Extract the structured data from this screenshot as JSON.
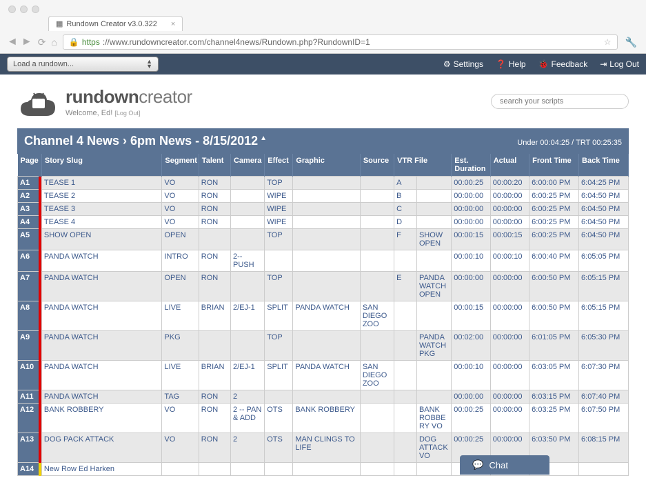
{
  "browser": {
    "tab_title": "Rundown Creator v3.0.322",
    "url_https": "https",
    "url_rest": "://www.rundowncreator.com/channel4news/Rundown.php?RundownID=1"
  },
  "header": {
    "load_label": "Load a rundown...",
    "settings": "Settings",
    "help": "Help",
    "feedback": "Feedback",
    "logout": "Log Out"
  },
  "logo": {
    "rundown": "rundown",
    "creator": "creator",
    "welcome": "Welcome, Ed!",
    "welcome_logout": "[Log Out]"
  },
  "search": {
    "placeholder": "search your scripts"
  },
  "title": {
    "channel": "Channel 4 News",
    "show": "6pm News - 8/15/2012"
  },
  "timing": {
    "under_label": "Under",
    "under_val": "00:04:25",
    "trt_label": "TRT",
    "trt_val": "00:25:35"
  },
  "columns": {
    "page": "Page",
    "slug": "Story Slug",
    "segment": "Segment",
    "talent": "Talent",
    "camera": "Camera",
    "effect": "Effect",
    "graphic": "Graphic",
    "source": "Source",
    "vtrfile": "VTR File",
    "est": "Est. Duration",
    "actual": "Actual",
    "front": "Front Time",
    "back": "Back Time"
  },
  "rows": [
    {
      "page": "A1",
      "slug": "TEASE 1",
      "segment": "VO",
      "talent": "RON",
      "camera": "",
      "effect": "TOP",
      "graphic": "",
      "source": "",
      "vtrfile": "A",
      "est": "00:00:25",
      "actual": "00:00:20",
      "front": "6:00:00 PM",
      "back": "6:04:25 PM",
      "bar": "red",
      "odd": true
    },
    {
      "page": "A2",
      "slug": "TEASE 2",
      "segment": "VO",
      "talent": "RON",
      "camera": "",
      "effect": "WIPE",
      "graphic": "",
      "source": "",
      "vtrfile": "B",
      "est": "00:00:00",
      "actual": "00:00:00",
      "front": "6:00:25 PM",
      "back": "6:04:50 PM",
      "bar": "red",
      "odd": false
    },
    {
      "page": "A3",
      "slug": "TEASE 3",
      "segment": "VO",
      "talent": "RON",
      "camera": "",
      "effect": "WIPE",
      "graphic": "",
      "source": "",
      "vtrfile": "C",
      "est": "00:00:00",
      "actual": "00:00:00",
      "front": "6:00:25 PM",
      "back": "6:04:50 PM",
      "bar": "red",
      "odd": true
    },
    {
      "page": "A4",
      "slug": "TEASE 4",
      "segment": "VO",
      "talent": "RON",
      "camera": "",
      "effect": "WIPE",
      "graphic": "",
      "source": "",
      "vtrfile": "D",
      "est": "00:00:00",
      "actual": "00:00:00",
      "front": "6:00:25 PM",
      "back": "6:04:50 PM",
      "bar": "red",
      "odd": false
    },
    {
      "page": "A5",
      "slug": "SHOW OPEN",
      "segment": "OPEN",
      "talent": "",
      "camera": "",
      "effect": "TOP",
      "graphic": "",
      "source": "",
      "vtrfile": "F",
      "vtr2": "SHOW OPEN",
      "est": "00:00:15",
      "actual": "00:00:15",
      "front": "6:00:25 PM",
      "back": "6:04:50 PM",
      "bar": "red",
      "odd": true
    },
    {
      "page": "A6",
      "slug": "PANDA WATCH",
      "segment": "INTRO",
      "talent": "RON",
      "camera": "2--PUSH",
      "effect": "",
      "graphic": "",
      "source": "",
      "vtrfile": "",
      "est": "00:00:10",
      "actual": "00:00:10",
      "front": "6:00:40 PM",
      "back": "6:05:05 PM",
      "bar": "red",
      "odd": false
    },
    {
      "page": "A7",
      "slug": "PANDA WATCH",
      "segment": "OPEN",
      "talent": "RON",
      "camera": "",
      "effect": "TOP",
      "graphic": "",
      "source": "",
      "vtrfile": "E",
      "vtr2": "PANDA WATCH OPEN",
      "est": "00:00:00",
      "actual": "00:00:00",
      "front": "6:00:50 PM",
      "back": "6:05:15 PM",
      "bar": "red",
      "odd": true
    },
    {
      "page": "A8",
      "slug": "PANDA WATCH",
      "segment": "LIVE",
      "talent": "BRIAN",
      "camera": "2/EJ-1",
      "effect": "SPLIT",
      "graphic": "PANDA WATCH",
      "source": "SAN DIEGO ZOO",
      "vtrfile": "",
      "est": "00:00:15",
      "actual": "00:00:00",
      "front": "6:00:50 PM",
      "back": "6:05:15 PM",
      "bar": "red",
      "odd": false
    },
    {
      "page": "A9",
      "slug": "PANDA WATCH",
      "segment": "PKG",
      "talent": "",
      "camera": "",
      "effect": "TOP",
      "graphic": "",
      "source": "",
      "vtrfile": "",
      "vtr2": "PANDA WATCH PKG",
      "est": "00:02:00",
      "actual": "00:00:00",
      "front": "6:01:05 PM",
      "back": "6:05:30 PM",
      "bar": "red",
      "odd": true
    },
    {
      "page": "A10",
      "slug": "PANDA WATCH",
      "segment": "LIVE",
      "talent": "BRIAN",
      "camera": "2/EJ-1",
      "effect": "SPLIT",
      "graphic": "PANDA WATCH",
      "source": "SAN DIEGO ZOO",
      "vtrfile": "",
      "est": "00:00:10",
      "actual": "00:00:00",
      "front": "6:03:05 PM",
      "back": "6:07:30 PM",
      "bar": "red",
      "odd": false
    },
    {
      "page": "A11",
      "slug": "PANDA WATCH",
      "segment": "TAG",
      "talent": "RON",
      "camera": "2",
      "effect": "",
      "graphic": "",
      "source": "",
      "vtrfile": "",
      "est": "00:00:00",
      "actual": "00:00:00",
      "front": "6:03:15 PM",
      "back": "6:07:40 PM",
      "bar": "red",
      "odd": true
    },
    {
      "page": "A12",
      "slug": "BANK ROBBERY",
      "segment": "VO",
      "talent": "RON",
      "camera": "2 -- PAN & ADD",
      "effect": "OTS",
      "graphic": "BANK ROBBERY",
      "source": "",
      "vtrfile": "",
      "vtr2": "BANK ROBBERY VO",
      "est": "00:00:25",
      "actual": "00:00:00",
      "front": "6:03:25 PM",
      "back": "6:07:50 PM",
      "bar": "red",
      "odd": false
    },
    {
      "page": "A13",
      "slug": "DOG PACK ATTACK",
      "segment": "VO",
      "talent": "RON",
      "camera": "2",
      "effect": "OTS",
      "graphic": "MAN CLINGS TO LIFE",
      "source": "",
      "vtrfile": "",
      "vtr2": "DOG ATTACK VO",
      "est": "00:00:25",
      "actual": "00:00:00",
      "front": "6:03:50 PM",
      "back": "6:08:15 PM",
      "bar": "red",
      "odd": true
    },
    {
      "page": "A14",
      "slug": "New Row Ed Harken",
      "segment": "",
      "talent": "",
      "camera": "",
      "effect": "",
      "graphic": "",
      "source": "",
      "vtrfile": "",
      "est": "",
      "actual": "",
      "front": "",
      "back": "",
      "bar": "yellow",
      "odd": false
    }
  ],
  "chat": {
    "label": "Chat"
  }
}
